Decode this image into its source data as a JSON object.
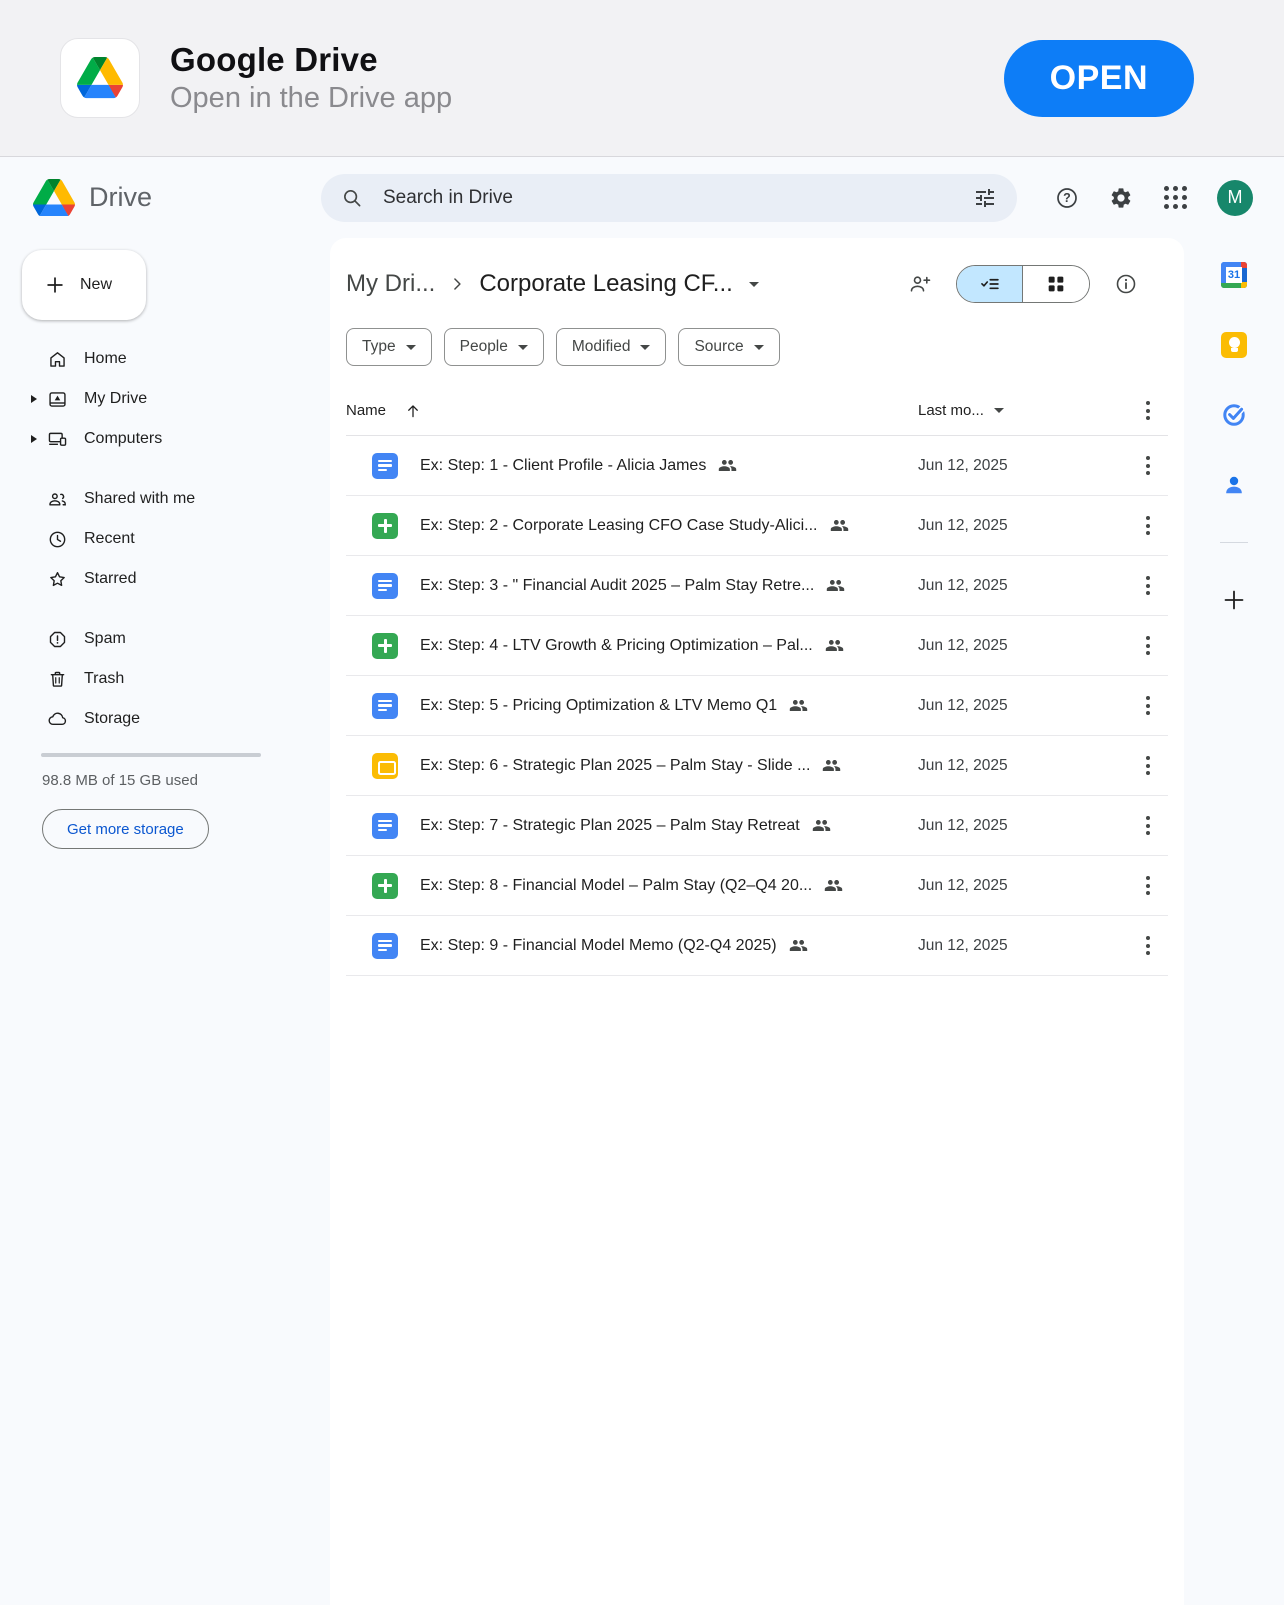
{
  "banner": {
    "title": "Google Drive",
    "subtitle": "Open in the Drive app",
    "open_label": "OPEN"
  },
  "header": {
    "product_name": "Drive",
    "search_placeholder": "Search in Drive",
    "avatar_initial": "M"
  },
  "sidebar": {
    "new_label": "New",
    "items": [
      {
        "label": "Home"
      },
      {
        "label": "My Drive"
      },
      {
        "label": "Computers"
      },
      {
        "label": "Shared with me"
      },
      {
        "label": "Recent"
      },
      {
        "label": "Starred"
      },
      {
        "label": "Spam"
      },
      {
        "label": "Trash"
      },
      {
        "label": "Storage"
      }
    ],
    "storage_used": "98.8 MB of 15 GB used",
    "get_more_label": "Get more storage"
  },
  "breadcrumb": {
    "parent": "My Dri...",
    "current": "Corporate Leasing CF..."
  },
  "filters": [
    {
      "label": "Type"
    },
    {
      "label": "People"
    },
    {
      "label": "Modified"
    },
    {
      "label": "Source"
    }
  ],
  "table": {
    "name_header": "Name",
    "modified_header": "Last mo...",
    "files": [
      {
        "name": "Ex: Step: 1 - Client Profile - Alicia James",
        "type": "doc",
        "modified": "Jun 12, 2025",
        "shared": true
      },
      {
        "name": "Ex: Step: 2 - Corporate Leasing CFO Case Study-Alici...",
        "type": "sheet",
        "modified": "Jun 12, 2025",
        "shared": true
      },
      {
        "name": "Ex: Step: 3 - \" Financial Audit 2025 – Palm Stay Retre...",
        "type": "doc",
        "modified": "Jun 12, 2025",
        "shared": true
      },
      {
        "name": "Ex: Step: 4 - LTV Growth & Pricing Optimization – Pal...",
        "type": "sheet",
        "modified": "Jun 12, 2025",
        "shared": true
      },
      {
        "name": "Ex: Step: 5 - Pricing Optimization & LTV Memo Q1",
        "type": "doc",
        "modified": "Jun 12, 2025",
        "shared": true
      },
      {
        "name": "Ex: Step: 6 - Strategic Plan 2025 – Palm Stay - Slide ...",
        "type": "slide",
        "modified": "Jun 12, 2025",
        "shared": true
      },
      {
        "name": "Ex: Step: 7 - Strategic Plan 2025 – Palm Stay Retreat",
        "type": "doc",
        "modified": "Jun 12, 2025",
        "shared": true
      },
      {
        "name": "Ex: Step: 8 - Financial Model – Palm Stay (Q2–Q4 20...",
        "type": "sheet",
        "modified": "Jun 12, 2025",
        "shared": true
      },
      {
        "name": "Ex: Step: 9 - Financial Model Memo (Q2-Q4 2025)",
        "type": "doc",
        "modified": "Jun 12, 2025",
        "shared": true
      }
    ]
  },
  "right_rail": {
    "calendar_label": "31"
  },
  "icons": {
    "search-icon": "magnifier",
    "tune-icon": "filter sliders",
    "help-icon": "question mark circle",
    "settings-icon": "gear",
    "apps-grid-icon": "3x3 dots",
    "person-add-icon": "share person",
    "list-view-icon": "check + list lines",
    "grid-view-icon": "2x2 squares",
    "info-icon": "i in circle",
    "shared-people-icon": "two people",
    "more-options-icon": "vertical dots"
  },
  "colors": {
    "accent_blue": "#0b57d0",
    "open_button": "#0d7df7",
    "docs": "#4285f4",
    "sheets": "#34a853",
    "slides": "#fbbc04",
    "toggle_selected": "#c2e7ff",
    "avatar": "#17876b"
  }
}
